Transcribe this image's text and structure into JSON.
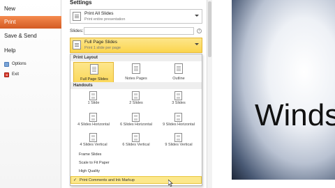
{
  "leftnav": {
    "items": [
      {
        "label": "New"
      },
      {
        "label": "Print"
      },
      {
        "label": "Save & Send"
      },
      {
        "label": "Help"
      }
    ],
    "subitems": [
      {
        "label": "Options",
        "icon": "options-icon"
      },
      {
        "label": "Exit",
        "icon": "exit-icon"
      }
    ]
  },
  "settings": {
    "title": "Settings",
    "print_range": {
      "main": "Print All Slides",
      "sub": "Print entire presentation"
    },
    "slides_label": "Slides:",
    "slides_value": "",
    "layout_dropdown": {
      "main": "Full Page Slides",
      "sub": "Print 1 slide per page"
    }
  },
  "menu": {
    "print_layout_header": "Print Layout",
    "layouts": [
      {
        "label": "Full Page Slides",
        "selected": true
      },
      {
        "label": "Notes Pages",
        "selected": false
      },
      {
        "label": "Outline",
        "selected": false
      }
    ],
    "handouts_header": "Handouts",
    "handouts": [
      {
        "label": "1 Slide"
      },
      {
        "label": "2 Slides"
      },
      {
        "label": "3 Slides"
      },
      {
        "label": "4 Slides Horizontal"
      },
      {
        "label": "6 Slides Horizontal"
      },
      {
        "label": "9 Slides Horizontal"
      },
      {
        "label": "4 Slides Vertical"
      },
      {
        "label": "6 Slides Vertical"
      },
      {
        "label": "9 Slides Vertical"
      }
    ],
    "toggles": [
      {
        "label": "Frame Slides",
        "checked": false
      },
      {
        "label": "Scale to Fit Paper",
        "checked": false
      },
      {
        "label": "High Quality",
        "checked": false
      },
      {
        "label": "Print Comments and Ink Markup",
        "checked": true
      }
    ]
  },
  "preview": {
    "slide_text": "Winds"
  },
  "colors": {
    "accent": "#e0682f",
    "highlight": "#fbd54e"
  }
}
